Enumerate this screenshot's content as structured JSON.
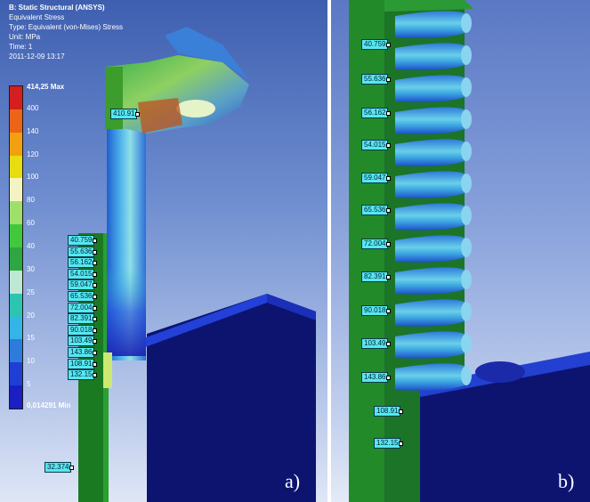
{
  "header": {
    "title": "B: Static Structural (ANSYS)",
    "result": "Equivalent Stress",
    "type": "Type: Equivalent (von-Mises) Stress",
    "unit": "Unit: MPa",
    "time": "Time: 1",
    "date": "2011-12-09 13:17"
  },
  "legend": {
    "max_label": "414,25 Max",
    "min_label": "0,014291 Min",
    "levels": [
      "400",
      "140",
      "120",
      "100",
      "80",
      "60",
      "40",
      "30",
      "25",
      "20",
      "15",
      "10",
      "5"
    ],
    "colors": [
      "#d51f1f",
      "#ec6418",
      "#f2a010",
      "#e7dd10",
      "#f4f4c2",
      "#9ee06a",
      "#41c83c",
      "#2ea641",
      "#bde9d4",
      "#2ec4b2",
      "#34b5e8",
      "#2d7bdc",
      "#1f3fd4",
      "#1a1fc4"
    ]
  },
  "panel_a": {
    "label": "a)",
    "top_probe": "410.91",
    "bottom_probe": "32.374",
    "probes": [
      "40.759",
      "55.636",
      "56.162",
      "54.015",
      "59.047",
      "65.536",
      "72.004",
      "82.391",
      "90.018",
      "103.49",
      "143.86",
      "108.91",
      "132.15"
    ]
  },
  "panel_b": {
    "label": "b)",
    "probes": [
      "40.759",
      "55.636",
      "56.162",
      "54.015",
      "59.047",
      "65.536",
      "72.004",
      "82.391",
      "90.018",
      "103.49",
      "143.86",
      "108.91",
      "132.15"
    ]
  }
}
